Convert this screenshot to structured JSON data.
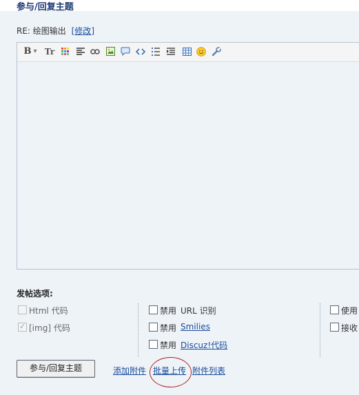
{
  "header": {
    "title": "参与/回复主题"
  },
  "subject": {
    "prefix": "RE: 绘图输出",
    "bracket_open": "[",
    "edit_link": "修改",
    "bracket_close": "]"
  },
  "toolbar": {
    "bold_label": "B",
    "dropdown_glyph": "▾",
    "font_size_label": "Tr"
  },
  "options": {
    "title": "发帖选项:",
    "col1": [
      {
        "label": "Html 代码",
        "checked": false,
        "disabled": true
      },
      {
        "label": "[img] 代码",
        "checked": true,
        "disabled": true
      }
    ],
    "col2": [
      {
        "prefix": "禁用",
        "label": "URL 识别",
        "link": false
      },
      {
        "prefix": "禁用",
        "label": "Smilies",
        "link": true
      },
      {
        "prefix": "禁用",
        "label": "Discuz!代码",
        "link": true
      }
    ],
    "col3": [
      {
        "label": "使用"
      },
      {
        "label": "接收"
      }
    ]
  },
  "actions": {
    "submit_label": "参与/回复主题",
    "add_attachment": "添加附件",
    "batch_upload": "批量上传",
    "attachment_list": "附件列表"
  },
  "colors": {
    "accent": "#1a4b9b",
    "annotation": "#b02020",
    "panel": "#eef3f8"
  }
}
